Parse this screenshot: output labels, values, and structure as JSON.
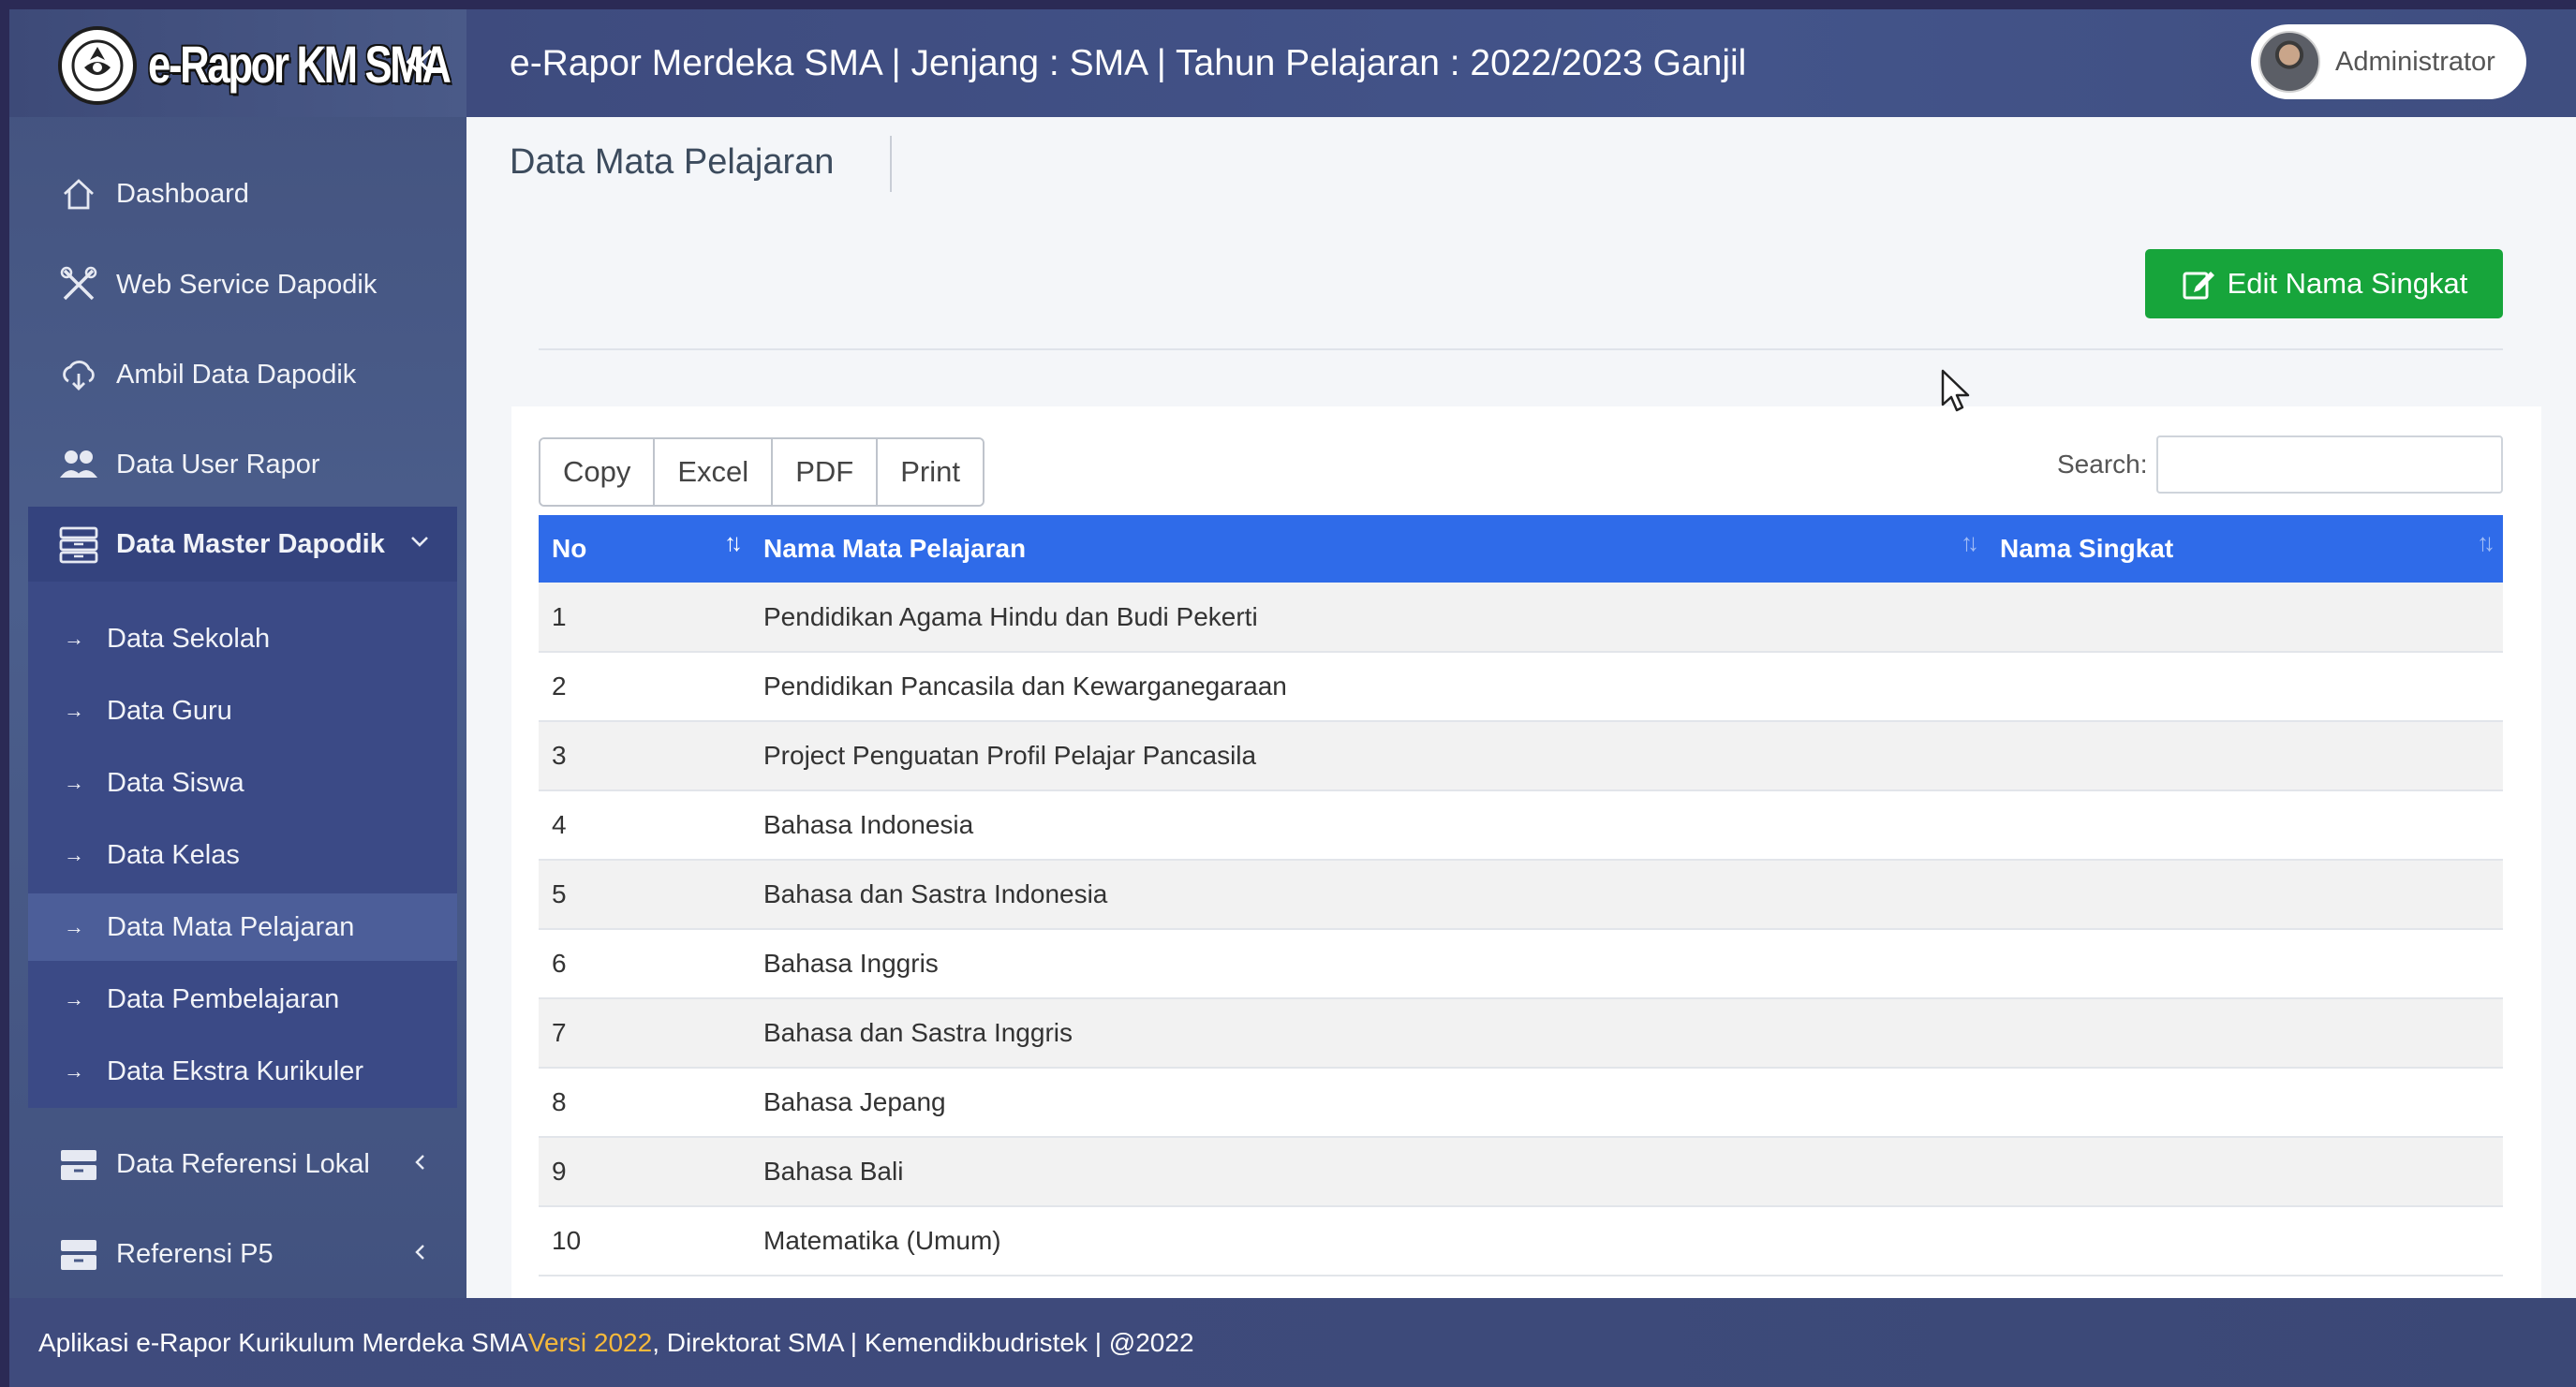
{
  "app": {
    "brand": "e-Rapor KM SMA",
    "collapse_icon": "double-chevron-left-icon"
  },
  "header": {
    "title": "e-Rapor Merdeka SMA | Jenjang : SMA | Tahun Pelajaran : 2022/2023 Ganjil",
    "user_name": "Administrator"
  },
  "sidebar": {
    "items": [
      {
        "label": "Dashboard",
        "icon": "home-icon"
      },
      {
        "label": "Web Service Dapodik",
        "icon": "tools-icon"
      },
      {
        "label": "Ambil Data Dapodik",
        "icon": "cloud-download-icon"
      },
      {
        "label": "Data User Rapor",
        "icon": "users-icon"
      },
      {
        "label": "Data Master Dapodik",
        "icon": "archive-icon",
        "expanded": true
      },
      {
        "label": "Data Referensi Lokal",
        "icon": "archive-icon"
      },
      {
        "label": "Referensi P5",
        "icon": "archive-icon"
      }
    ],
    "sub_items": [
      {
        "label": "Data Sekolah"
      },
      {
        "label": "Data Guru"
      },
      {
        "label": "Data Siswa"
      },
      {
        "label": "Data Kelas"
      },
      {
        "label": "Data Mata Pelajaran",
        "active": true
      },
      {
        "label": "Data Pembelajaran"
      },
      {
        "label": "Data Ekstra Kurikuler"
      }
    ],
    "chevron_down": "⌵",
    "chevron_left": "‹"
  },
  "main": {
    "page_title": "Data Mata Pelajaran",
    "edit_button": "Edit Nama Singkat",
    "export_buttons": [
      "Copy",
      "Excel",
      "PDF",
      "Print"
    ],
    "search_label": "Search:",
    "search_value": "",
    "columns": [
      "No",
      "Nama Mata Pelajaran",
      "Nama Singkat"
    ],
    "rows": [
      {
        "no": "1",
        "nama": "Pendidikan Agama Hindu dan Budi Pekerti",
        "singkat": ""
      },
      {
        "no": "2",
        "nama": "Pendidikan Pancasila dan Kewarganegaraan",
        "singkat": ""
      },
      {
        "no": "3",
        "nama": "Project Penguatan Profil Pelajar Pancasila",
        "singkat": ""
      },
      {
        "no": "4",
        "nama": "Bahasa Indonesia",
        "singkat": ""
      },
      {
        "no": "5",
        "nama": "Bahasa dan Sastra Indonesia",
        "singkat": ""
      },
      {
        "no": "6",
        "nama": "Bahasa Inggris",
        "singkat": ""
      },
      {
        "no": "7",
        "nama": "Bahasa dan Sastra Inggris",
        "singkat": ""
      },
      {
        "no": "8",
        "nama": "Bahasa Jepang",
        "singkat": ""
      },
      {
        "no": "9",
        "nama": "Bahasa Bali",
        "singkat": ""
      },
      {
        "no": "10",
        "nama": "Matematika (Umum)",
        "singkat": ""
      }
    ]
  },
  "footer": {
    "prefix": "Aplikasi e-Rapor Kurikulum Merdeka SMA ",
    "version": "Versi 2022",
    "suffix": ", Direktorat SMA | Kemendikbudristek | @2022"
  },
  "colors": {
    "table_header": "#2f6be9",
    "edit_button": "#17a53b",
    "version_text": "#f6b93b"
  }
}
